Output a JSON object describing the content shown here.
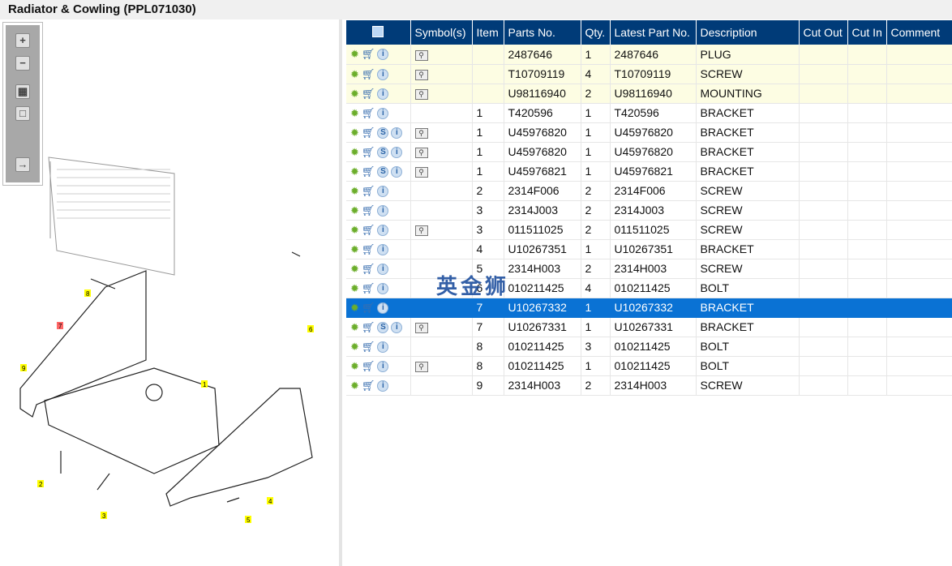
{
  "title": "Radiator & Cowling (PPL071030)",
  "toolbar": {
    "zoom_in": "zoom-in",
    "zoom_out": "zoom-out",
    "fit": "fit",
    "actual": "actual",
    "export": "export"
  },
  "diagram": {
    "callouts": [
      "1",
      "2",
      "3",
      "4",
      "5",
      "6",
      "7",
      "8",
      "9"
    ]
  },
  "table": {
    "headers": [
      "",
      "Symbol(s)",
      "Item",
      "Parts No.",
      "Qty.",
      "Latest Part No.",
      "Description",
      "Cut Out",
      "Cut In",
      "Comment"
    ],
    "rows": [
      {
        "s": false,
        "book": true,
        "item": "",
        "part": "2487646",
        "qty": "1",
        "latest": "2487646",
        "desc": "PLUG",
        "hl": "yellow"
      },
      {
        "s": false,
        "book": true,
        "item": "",
        "part": "T10709119",
        "qty": "4",
        "latest": "T10709119",
        "desc": "SCREW",
        "hl": "yellow"
      },
      {
        "s": false,
        "book": true,
        "item": "",
        "part": "U98116940",
        "qty": "2",
        "latest": "U98116940",
        "desc": "MOUNTING",
        "hl": "yellow"
      },
      {
        "s": false,
        "book": false,
        "item": "1",
        "part": "T420596",
        "qty": "1",
        "latest": "T420596",
        "desc": "BRACKET",
        "hl": ""
      },
      {
        "s": true,
        "book": true,
        "item": "1",
        "part": "U45976820",
        "qty": "1",
        "latest": "U45976820",
        "desc": "BRACKET",
        "hl": ""
      },
      {
        "s": true,
        "book": true,
        "item": "1",
        "part": "U45976820",
        "qty": "1",
        "latest": "U45976820",
        "desc": "BRACKET",
        "hl": ""
      },
      {
        "s": true,
        "book": true,
        "item": "1",
        "part": "U45976821",
        "qty": "1",
        "latest": "U45976821",
        "desc": "BRACKET",
        "hl": ""
      },
      {
        "s": false,
        "book": false,
        "item": "2",
        "part": "2314F006",
        "qty": "2",
        "latest": "2314F006",
        "desc": "SCREW",
        "hl": ""
      },
      {
        "s": false,
        "book": false,
        "item": "3",
        "part": "2314J003",
        "qty": "2",
        "latest": "2314J003",
        "desc": "SCREW",
        "hl": ""
      },
      {
        "s": false,
        "book": true,
        "item": "3",
        "part": "011511025",
        "qty": "2",
        "latest": "011511025",
        "desc": "SCREW",
        "hl": ""
      },
      {
        "s": false,
        "book": false,
        "item": "4",
        "part": "U10267351",
        "qty": "1",
        "latest": "U10267351",
        "desc": "BRACKET",
        "hl": ""
      },
      {
        "s": false,
        "book": false,
        "item": "5",
        "part": "2314H003",
        "qty": "2",
        "latest": "2314H003",
        "desc": "SCREW",
        "hl": ""
      },
      {
        "s": false,
        "book": false,
        "item": "6",
        "part": "010211425",
        "qty": "4",
        "latest": "010211425",
        "desc": "BOLT",
        "hl": ""
      },
      {
        "s": false,
        "book": false,
        "item": "7",
        "part": "U10267332",
        "qty": "1",
        "latest": "U10267332",
        "desc": "BRACKET",
        "hl": "sel"
      },
      {
        "s": true,
        "book": true,
        "item": "7",
        "part": "U10267331",
        "qty": "1",
        "latest": "U10267331",
        "desc": "BRACKET",
        "hl": ""
      },
      {
        "s": false,
        "book": false,
        "item": "8",
        "part": "010211425",
        "qty": "3",
        "latest": "010211425",
        "desc": "BOLT",
        "hl": ""
      },
      {
        "s": false,
        "book": true,
        "item": "8",
        "part": "010211425",
        "qty": "1",
        "latest": "010211425",
        "desc": "BOLT",
        "hl": ""
      },
      {
        "s": false,
        "book": false,
        "item": "9",
        "part": "2314H003",
        "qty": "2",
        "latest": "2314H003",
        "desc": "SCREW",
        "hl": ""
      }
    ]
  },
  "watermark": "英金狮",
  "colors": {
    "header": "#003b78",
    "selected": "#0a72d4",
    "highlight": "#fdfde3"
  }
}
